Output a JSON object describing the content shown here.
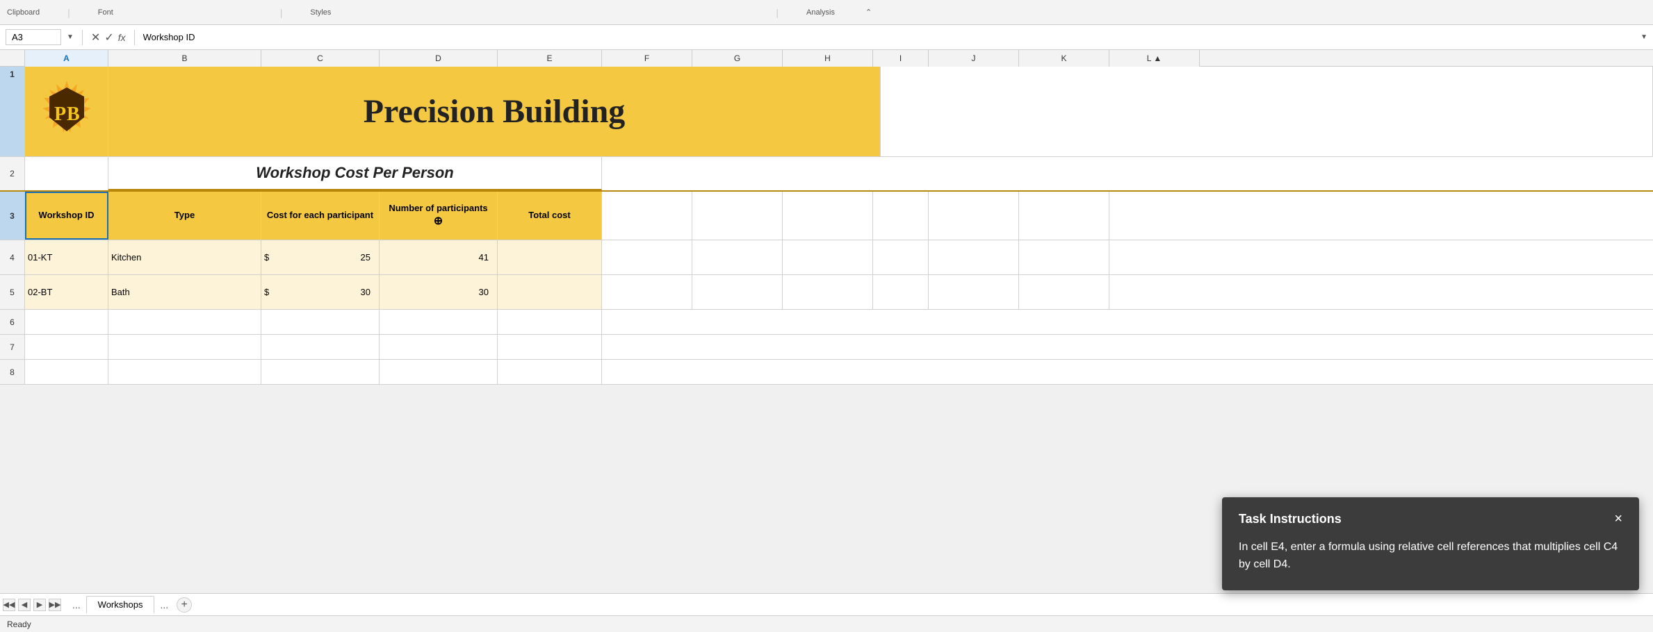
{
  "ribbon": {
    "groups": [
      "Clipboard",
      "Font",
      "Styles",
      "Analysis"
    ],
    "formula_bar": {
      "cell_ref": "A3",
      "formula_value": "Workshop ID"
    }
  },
  "columns": {
    "headers": [
      "A",
      "B",
      "C",
      "D",
      "E",
      "F",
      "G",
      "H",
      "I",
      "J",
      "K",
      "L"
    ],
    "selected": "A"
  },
  "rows": {
    "row1": {
      "num": "1",
      "logo_text": "PB",
      "title": "Precision Building"
    },
    "row2": {
      "num": "2",
      "title": "Workshop Cost Per Person"
    },
    "row3": {
      "num": "3",
      "col_a": "Workshop ID",
      "col_b": "Type",
      "col_c": "Cost for each participant",
      "col_d": "Number of participants",
      "col_e": "Total cost"
    },
    "row4": {
      "num": "4",
      "col_a": "01-KT",
      "col_b": "Kitchen",
      "col_c": "$",
      "col_c2": "25",
      "col_d": "41",
      "col_e": ""
    },
    "row5": {
      "num": "5",
      "col_a": "02-BT",
      "col_b": "Bath",
      "col_c": "$",
      "col_c2": "30",
      "col_d": "30",
      "col_e": ""
    }
  },
  "sheet_tabs": {
    "active": "Workshops",
    "dots_left": "...",
    "dots_right": "...",
    "add_label": "+"
  },
  "status_bar": {
    "text": "Ready"
  },
  "task_panel": {
    "title": "Task Instructions",
    "close_label": "×",
    "body": "In cell E4, enter a formula using relative cell references that multiplies cell C4 by cell D4."
  }
}
